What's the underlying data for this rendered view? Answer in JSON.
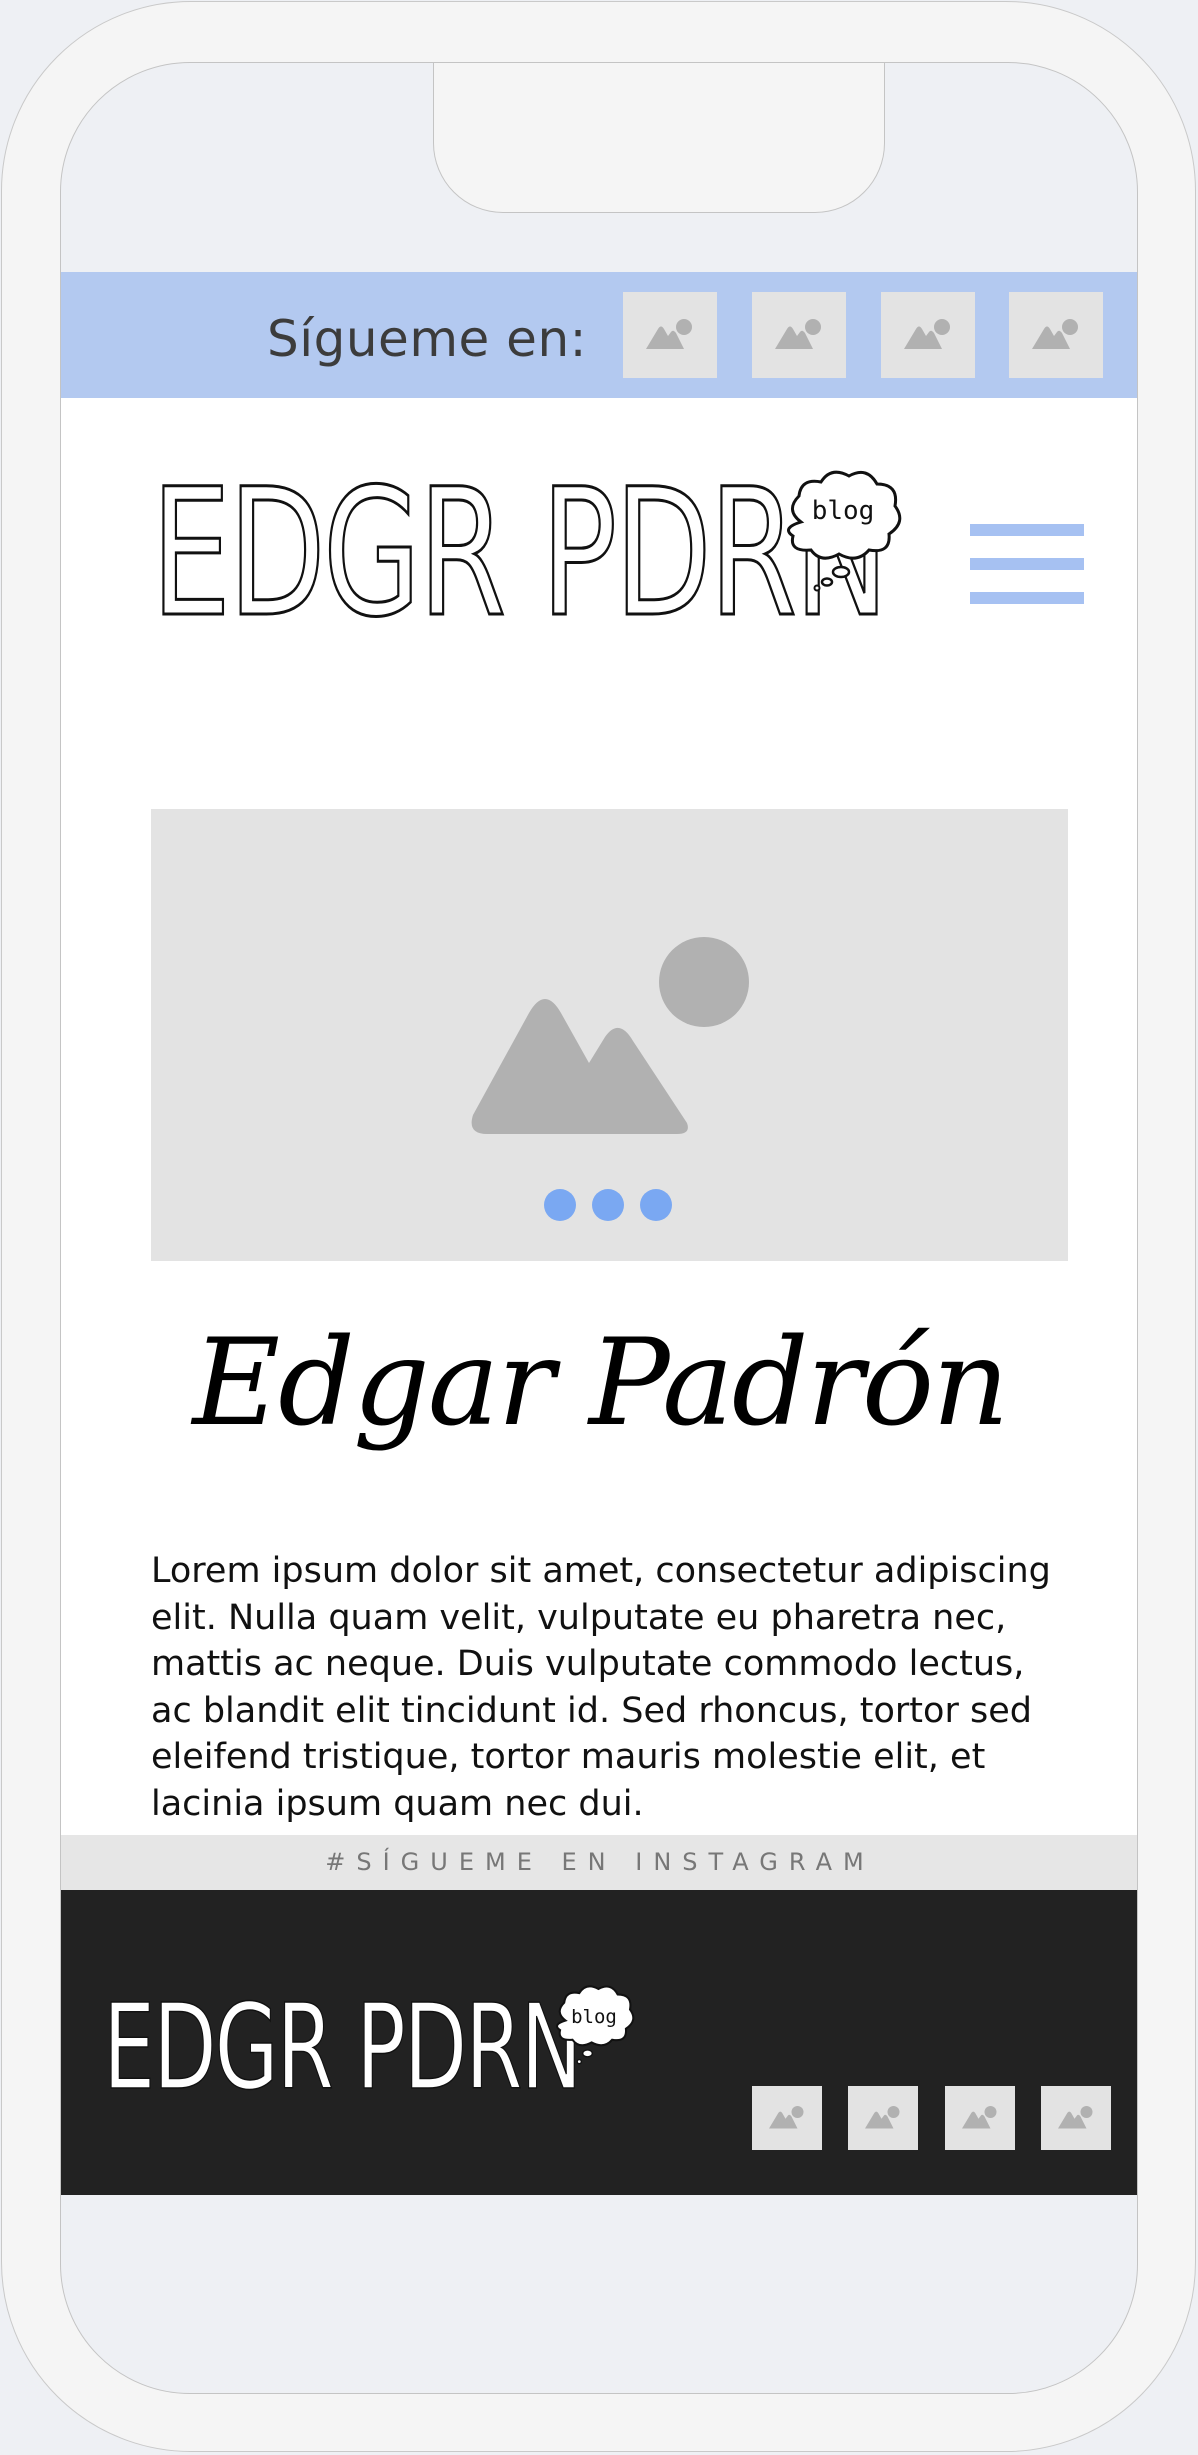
{
  "social": {
    "label": "Sígueme en:",
    "links": [
      {
        "icon": "image-placeholder-icon"
      },
      {
        "icon": "image-placeholder-icon"
      },
      {
        "icon": "image-placeholder-icon"
      },
      {
        "icon": "image-placeholder-icon"
      }
    ]
  },
  "header": {
    "logo": "EDGR PDRN",
    "logo_bubble": "blog",
    "menu_icon": "hamburger-menu-icon"
  },
  "carousel": {
    "image_icon": "image-placeholder-icon",
    "slides_count": 3
  },
  "profile": {
    "name": "Edgar Padrón",
    "bio": "Lorem ipsum dolor sit amet, consectetur adipiscing elit. Nulla quam velit, vulputate eu pharetra nec, mattis ac neque. Duis vulputate commodo lectus, ac blandit elit tincidunt id. Sed rhoncus, tortor sed eleifend tristique, tortor mauris molestie elit, et lacinia ipsum quam nec dui."
  },
  "instagram": {
    "label": "#SÍGUEME EN INSTAGRAM"
  },
  "footer": {
    "logo": "EDGR PDRN",
    "logo_bubble": "blog",
    "links": [
      {
        "icon": "image-placeholder-icon"
      },
      {
        "icon": "image-placeholder-icon"
      },
      {
        "icon": "image-placeholder-icon"
      },
      {
        "icon": "image-placeholder-icon"
      }
    ]
  },
  "colors": {
    "accent_blue": "#b3c9f0",
    "menu_blue": "#a6c1f2",
    "dot_blue": "#7aa8f2",
    "footer_bg": "#222222",
    "placeholder_bg": "#e3e3e3"
  }
}
